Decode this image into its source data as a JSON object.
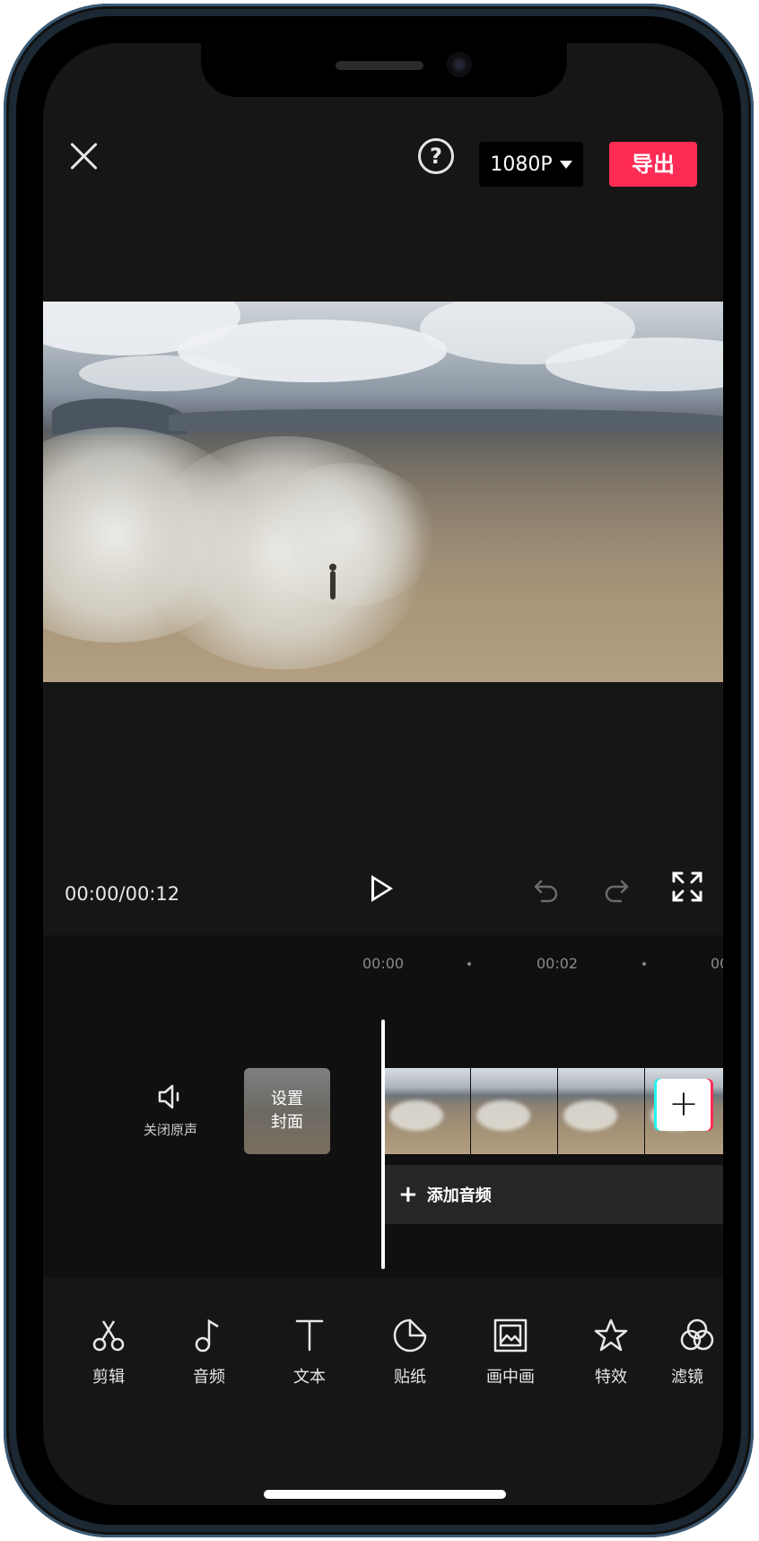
{
  "topbar": {
    "close_icon": "close-icon",
    "help_glyph": "?",
    "resolution_label": "1080P",
    "export_label": "导出",
    "export_color": "#fe2c55"
  },
  "player": {
    "timecode": "00:00/00:12"
  },
  "timeline": {
    "ticks": [
      "00:00",
      "00:02",
      "00"
    ],
    "mute_label": "关闭原声",
    "cover_label_line1": "设置",
    "cover_label_line2": "封面",
    "add_clip_glyph": "+",
    "add_audio_plus": "+",
    "add_audio_label": "添加音频"
  },
  "toolbar": {
    "items": [
      {
        "label": "剪辑",
        "icon": "scissors-icon"
      },
      {
        "label": "音频",
        "icon": "music-note-icon"
      },
      {
        "label": "文本",
        "icon": "text-icon"
      },
      {
        "label": "贴纸",
        "icon": "sticker-icon"
      },
      {
        "label": "画中画",
        "icon": "picture-in-picture-icon"
      },
      {
        "label": "特效",
        "icon": "star-effects-icon"
      },
      {
        "label": "滤镜",
        "icon": "filter-icon"
      }
    ]
  }
}
